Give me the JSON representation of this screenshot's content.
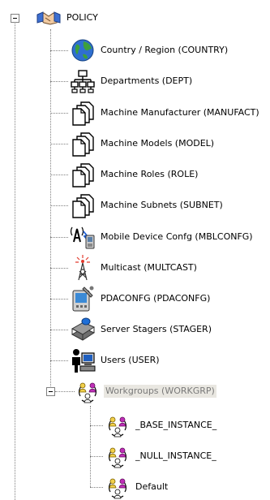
{
  "tree": {
    "root": {
      "label": "POLICY",
      "icon": "handshake-icon",
      "expanded": true
    },
    "items": [
      {
        "label": "Country / Region (COUNTRY)",
        "icon": "globe-icon"
      },
      {
        "label": "Departments (DEPT)",
        "icon": "org-chart-icon"
      },
      {
        "label": "Machine Manufacturer (MANUFACT)",
        "icon": "document-stack-icon"
      },
      {
        "label": "Machine Models (MODEL)",
        "icon": "document-stack-icon"
      },
      {
        "label": "Machine Roles (ROLE)",
        "icon": "document-stack-icon"
      },
      {
        "label": "Machine Subnets (SUBNET)",
        "icon": "document-stack-icon"
      },
      {
        "label": "Mobile Device Confg (MBLCONFG)",
        "icon": "mobile-device-icon"
      },
      {
        "label": "Multicast (MULTCAST)",
        "icon": "broadcast-tower-icon"
      },
      {
        "label": "PDACONFG (PDACONFG)",
        "icon": "pda-icon"
      },
      {
        "label": "Server Stagers (STAGER)",
        "icon": "server-stager-icon"
      },
      {
        "label": "Users (USER)",
        "icon": "user-computer-icon"
      },
      {
        "label": "Workgroups (WORKGRP)",
        "icon": "workgroup-icon",
        "expanded": true,
        "selected": true
      }
    ],
    "workgroup_children": [
      {
        "label": "_BASE_INSTANCE_",
        "icon": "workgroup-icon"
      },
      {
        "label": "_NULL_INSTANCE_",
        "icon": "workgroup-icon"
      },
      {
        "label": "Default",
        "icon": "workgroup-icon"
      }
    ]
  },
  "colors": {
    "selection_background": "#e9e7e1",
    "selection_text": "#7a7a7a",
    "tree_lines": "#808080",
    "globe_blue": "#2f6fd0",
    "globe_green": "#3da03d",
    "workgroup_yellow": "#f2d04a",
    "workgroup_magenta": "#c02fb8"
  }
}
